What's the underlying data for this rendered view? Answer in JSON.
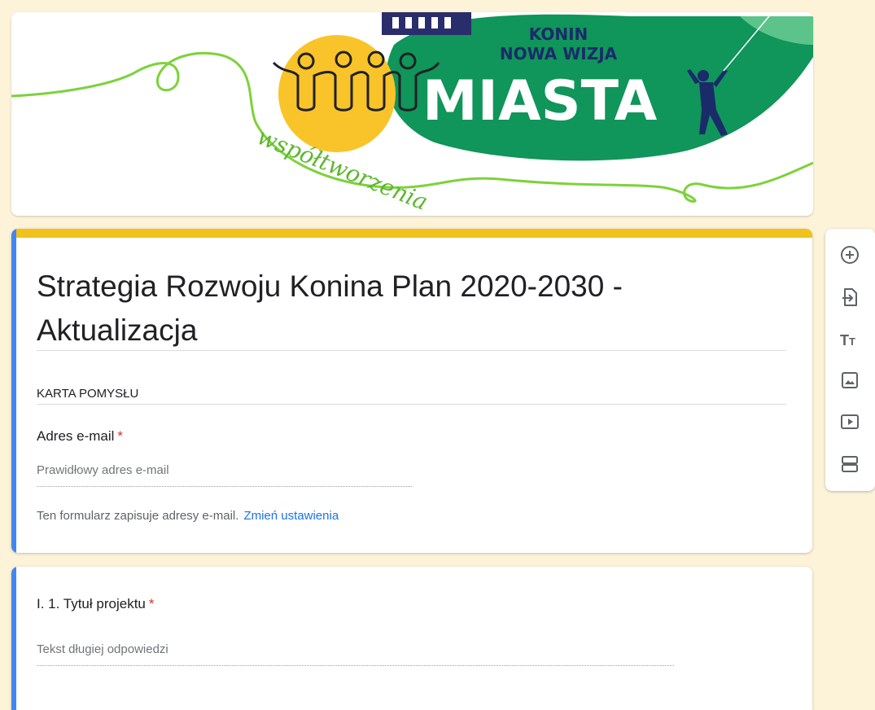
{
  "banner": {
    "line1": "KONIN",
    "line2": "NOWA WIZJA",
    "big": "MIASTA",
    "script": "współtworzenia",
    "colors": {
      "green": "#10955a",
      "yellow": "#f9c42a",
      "lime": "#7dd23b",
      "navy": "#2a2d6c"
    }
  },
  "form": {
    "title": "Strategia Rozwoju Konina Plan 2020-2030 - Aktualizacja",
    "description": "KARTA POMYSŁU",
    "email": {
      "label": "Adres e-mail",
      "required_mark": "*",
      "placeholder": "Prawidłowy adres e-mail",
      "note": "Ten formularz zapisuje adresy e-mail.",
      "settings_link": "Zmień ustawienia"
    },
    "question1": {
      "label": "I. 1. Tytuł projektu",
      "required_mark": "*",
      "placeholder": "Tekst długiej odpowiedzi"
    }
  },
  "toolbar": {
    "items": [
      {
        "icon": "add-question-icon"
      },
      {
        "icon": "import-questions-icon"
      },
      {
        "icon": "add-title-icon"
      },
      {
        "icon": "add-image-icon"
      },
      {
        "icon": "add-video-icon"
      },
      {
        "icon": "add-section-icon"
      }
    ]
  },
  "colors": {
    "accent_blue": "#4285f4",
    "header_yellow": "#f0c21b",
    "required_red": "#d93025",
    "link_blue": "#1a73e8",
    "page_bg": "#fdf3d8"
  }
}
